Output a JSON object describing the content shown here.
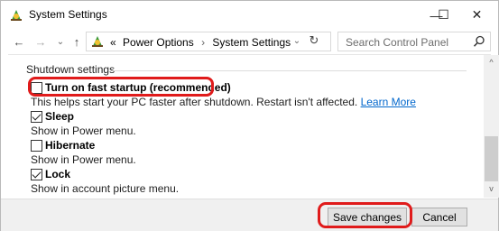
{
  "window": {
    "title": "System Settings",
    "minimize_glyph": "—",
    "maximize_glyph": "☐",
    "close_glyph": "✕"
  },
  "navigation": {
    "back_glyph": "←",
    "forward_glyph": "→",
    "recent_glyph": "⌄",
    "up_glyph": "↑",
    "breadcrumb_overflow": "«",
    "breadcrumb": [
      "Power Options",
      "System Settings"
    ],
    "breadcrumb_separator": "›",
    "dropdown_glyph": "⌄",
    "refresh_glyph": "↻"
  },
  "search": {
    "placeholder": "Search Control Panel"
  },
  "shutdown": {
    "section_title": "Shutdown settings",
    "options": [
      {
        "label": "Turn on fast startup (recommended)",
        "checked": false,
        "description": "This helps start your PC faster after shutdown. Restart isn't affected.",
        "link": "Learn More"
      },
      {
        "label": "Sleep",
        "checked": true,
        "description": "Show in Power menu."
      },
      {
        "label": "Hibernate",
        "checked": false,
        "description": "Show in Power menu."
      },
      {
        "label": "Lock",
        "checked": true,
        "description": "Show in account picture menu."
      }
    ]
  },
  "scrollbar": {
    "up_glyph": "^",
    "down_glyph": "v"
  },
  "footer": {
    "save_label": "Save changes",
    "cancel_label": "Cancel"
  },
  "colors": {
    "highlight": "#e01b1b",
    "link": "#0066cc"
  }
}
